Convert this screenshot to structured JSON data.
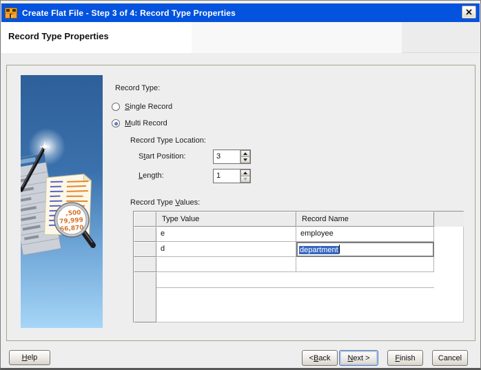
{
  "window": {
    "title": "Create Flat File - Step 3 of 4: Record Type Properties"
  },
  "header": {
    "title": "Record Type Properties"
  },
  "form": {
    "record_type_label": "Record Type:",
    "single_radio_label": {
      "text": "Single Record",
      "m": 0
    },
    "multi_radio_label": {
      "text": "Multi Record",
      "m": 0
    },
    "record_type_selected": "Multi Record",
    "location_label": "Record Type Location:",
    "start_position_label": {
      "text": "Start Position:",
      "m": 1
    },
    "start_position_value": "3",
    "length_label": {
      "text": "Length:",
      "m": 0
    },
    "length_value": "1",
    "values_label": {
      "text": "Record Type Values:",
      "m": 12
    }
  },
  "table": {
    "columns": [
      "Type Value",
      "Record Name"
    ],
    "rows": [
      [
        "e",
        "employee"
      ],
      [
        "d",
        "department"
      ],
      [
        "",
        ""
      ]
    ],
    "editor": {
      "row_index": 1,
      "column_index": 1,
      "text_selected": true
    }
  },
  "buttons": {
    "help": {
      "text": "Help",
      "m": 0
    },
    "back": {
      "text": "< Back",
      "m": 2
    },
    "next": {
      "text": "Next >",
      "m": 0
    },
    "finish": {
      "text": "Finish",
      "m": 0
    },
    "cancel": {
      "text": "Cancel",
      "m": -1
    },
    "focused": "next"
  },
  "art": {
    "lens_numbers": [
      ",500",
      "79,999",
      "66,870"
    ]
  },
  "colors": {
    "titlebar": "#0453df",
    "selection": "#3465c0",
    "panel_blue": "#2e5f99",
    "dialog_bg": "#eeeeee"
  }
}
